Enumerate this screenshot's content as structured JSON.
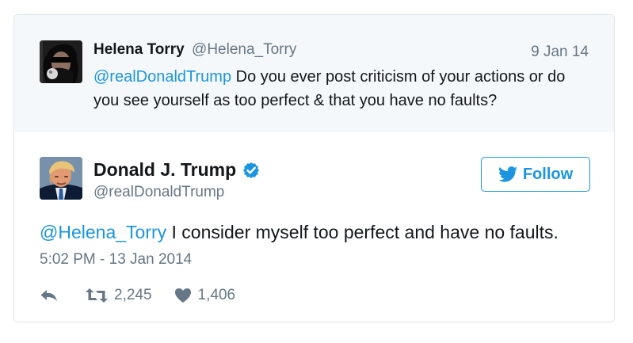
{
  "parent_tweet": {
    "name": "Helena Torry",
    "handle": "@Helena_Torry",
    "date": "9 Jan 14",
    "mention": "@realDonaldTrump",
    "text": " Do you ever post criticism of your actions or do you see yourself as too perfect & that you have no faults?"
  },
  "main_tweet": {
    "name": "Donald J. Trump",
    "handle": "@realDonaldTrump",
    "follow_label": "Follow",
    "mention": "@Helena_Torry",
    "text": " I consider myself too perfect and have no faults.",
    "timestamp": "5:02 PM - 13 Jan 2014",
    "retweets": "2,245",
    "likes": "1,406"
  },
  "colors": {
    "link": "#1b95e0",
    "secondary_text": "#657786",
    "parent_background": "#f5f8fa"
  },
  "icons": [
    "verified-icon",
    "twitter-bird-icon",
    "reply-icon",
    "retweet-icon",
    "heart-icon"
  ]
}
